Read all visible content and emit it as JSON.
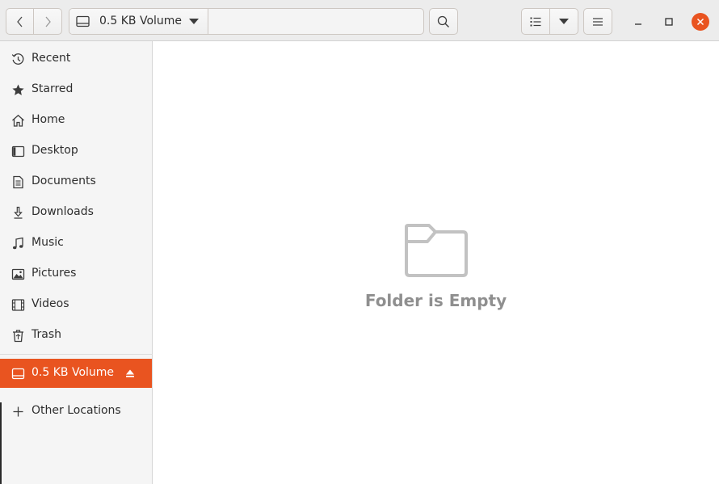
{
  "header": {
    "location_label": "0.5 KB Volume",
    "icons": {
      "back": "chevron-left-icon",
      "forward": "chevron-right-icon",
      "drive": "drive-icon",
      "search": "search-icon",
      "list_view": "list-view-icon",
      "view_options": "dropdown-arrow-icon",
      "menu": "hamburger-menu-icon",
      "minimize": "minimize-icon",
      "maximize": "maximize-icon",
      "close": "close-icon"
    }
  },
  "sidebar": {
    "items": [
      {
        "label": "Recent",
        "icon": "clock-icon"
      },
      {
        "label": "Starred",
        "icon": "star-icon"
      },
      {
        "label": "Home",
        "icon": "home-icon"
      },
      {
        "label": "Desktop",
        "icon": "desktop-icon"
      },
      {
        "label": "Documents",
        "icon": "document-icon"
      },
      {
        "label": "Downloads",
        "icon": "download-icon"
      },
      {
        "label": "Music",
        "icon": "music-icon"
      },
      {
        "label": "Pictures",
        "icon": "picture-icon"
      },
      {
        "label": "Videos",
        "icon": "video-icon"
      },
      {
        "label": "Trash",
        "icon": "trash-icon"
      }
    ],
    "volume": {
      "label": "0.5 KB Volume",
      "icon": "drive-icon",
      "action_icon": "eject-icon"
    },
    "other": {
      "label": "Other Locations",
      "icon": "plus-icon"
    }
  },
  "content": {
    "empty_message": "Folder is Empty",
    "empty_icon": "folder-icon"
  },
  "colors": {
    "accent": "#e95420",
    "headerbar": "#ececec",
    "sidebar": "#f5f5f5",
    "empty_text": "#8f8f8f"
  }
}
